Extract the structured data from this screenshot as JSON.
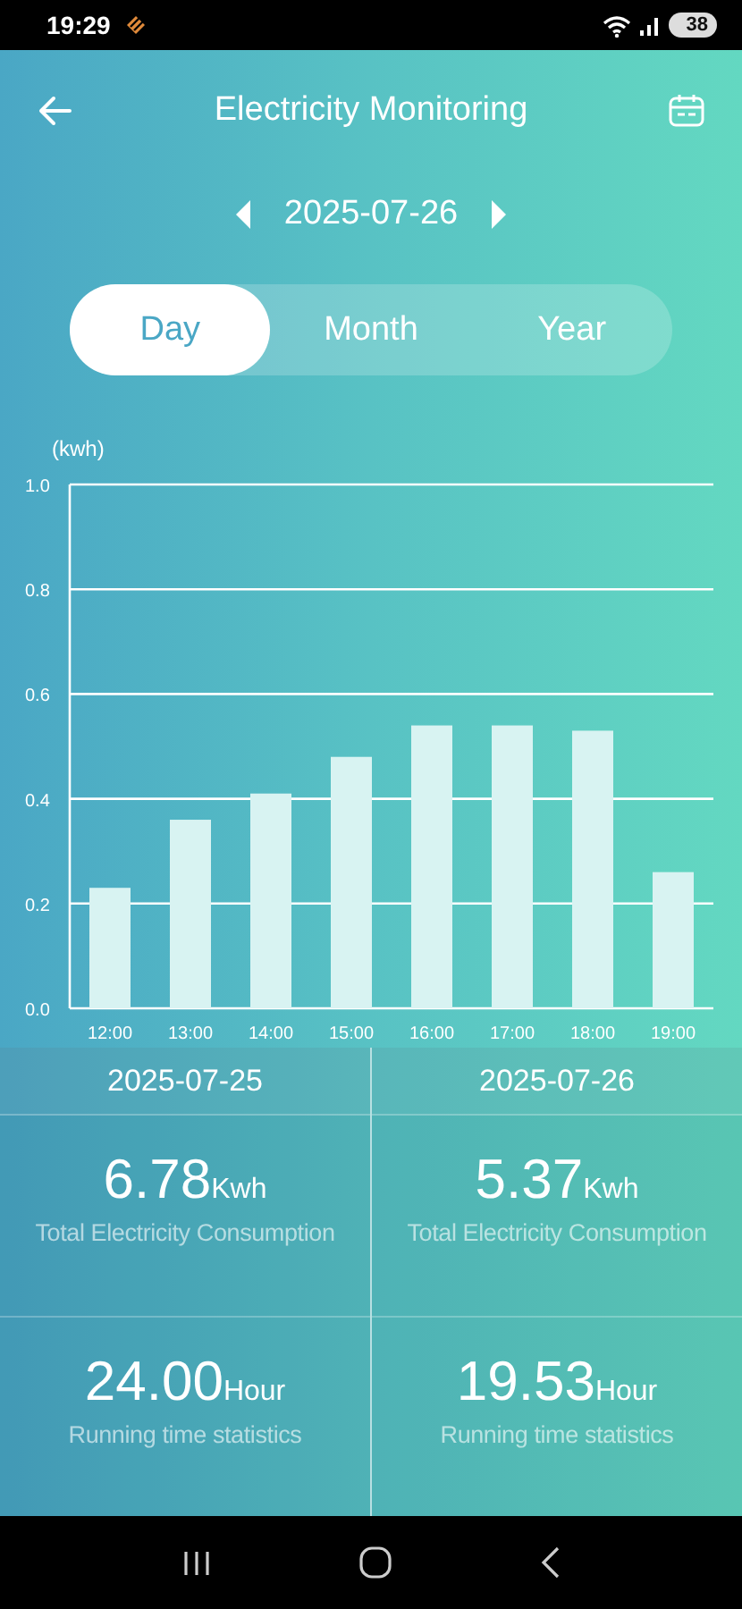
{
  "status_bar": {
    "time": "19:29",
    "battery": "38"
  },
  "header": {
    "title": "Electricity Monitoring"
  },
  "date_nav": {
    "date": "2025-07-26"
  },
  "tabs": [
    {
      "label": "Day",
      "selected": true
    },
    {
      "label": "Month",
      "selected": false
    },
    {
      "label": "Year",
      "selected": false
    }
  ],
  "chart_data": {
    "type": "bar",
    "ylabel": "(kwh)",
    "categories": [
      "12:00",
      "13:00",
      "14:00",
      "15:00",
      "16:00",
      "17:00",
      "18:00",
      "19:00"
    ],
    "values": [
      0.23,
      0.36,
      0.41,
      0.48,
      0.54,
      0.54,
      0.53,
      0.26
    ],
    "ylim": [
      0,
      1
    ],
    "grid": true,
    "yticks": [
      {
        "value": 0,
        "label": "0.0"
      },
      {
        "value": 0.2,
        "label": "0.2"
      },
      {
        "value": 0.4,
        "label": "0.4"
      },
      {
        "value": 0.6,
        "label": "0.6"
      },
      {
        "value": 0.8,
        "label": "0.8"
      },
      {
        "value": 1,
        "label": "1.0"
      }
    ]
  },
  "comparison": {
    "columns": [
      {
        "date": "2025-07-25",
        "stats": [
          {
            "value": "6.78",
            "unit": "Kwh",
            "label": "Total Electricity Consumption"
          },
          {
            "value": "24.00",
            "unit": "Hour",
            "label": "Running time statistics"
          }
        ]
      },
      {
        "date": "2025-07-26",
        "stats": [
          {
            "value": "5.37",
            "unit": "Kwh",
            "label": "Total Electricity Consumption"
          },
          {
            "value": "19.53",
            "unit": "Hour",
            "label": "Running time statistics"
          }
        ]
      }
    ]
  }
}
